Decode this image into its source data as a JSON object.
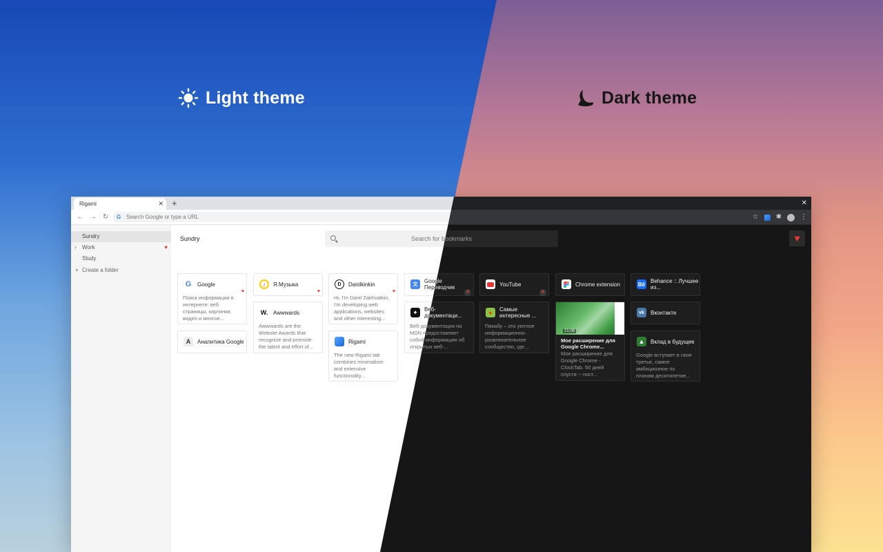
{
  "hero": {
    "light_label": "Light theme",
    "dark_label": "Dark theme",
    "light_icon": "sun-icon",
    "dark_icon": "moon-icon"
  },
  "browser": {
    "tab_title": "Rigami",
    "omnibox_placeholder": "Search Google or type a URL"
  },
  "sidebar": {
    "folders": [
      {
        "label": "Sundry"
      },
      {
        "label": "Work"
      },
      {
        "label": "Study"
      }
    ],
    "create_label": "Create a folder"
  },
  "main": {
    "folder_title": "Sundry",
    "search_placeholder": "Search for bookmarks"
  },
  "colors": {
    "heart": "#e53935",
    "dark_bg": "#161616",
    "light_bg": "#ffffff"
  },
  "cards": {
    "google": {
      "title": "Google",
      "desc": "Поиск информации в интернете: веб страницы, картинки, видео и многое..."
    },
    "analytics": {
      "title": "Аналитика Google"
    },
    "yamusic": {
      "title": "Я.Музыка"
    },
    "awwwards": {
      "title": "Awwwards",
      "desc": "Awwwards are the Website Awards that recognize and promote the talent and effort of..."
    },
    "danil": {
      "title": "Danilkinkin",
      "desc": "Hi, I'm Danil Zakhvatkin, I'm developing web applications, websites and other interesting..."
    },
    "rigami": {
      "title": "Rigami",
      "desc": "The new Rigami tab combines minimalism and extensive functionality..."
    },
    "translate": {
      "title": "Google Переводчик"
    },
    "mdn": {
      "title": "Веб-документаци...",
      "desc": "Веб-документация на MDN предоставляет собой информацию об открытых веб-..."
    },
    "youtube": {
      "title": "YouTube"
    },
    "pikabu": {
      "title": "Самые интересные ...",
      "desc": "Пикабу – это уютное информационно-развлекательное сообщество, где..."
    },
    "chrome": {
      "title": "Chrome extension"
    },
    "clocktab": {
      "title": "Мое расширение для Google Chrome...",
      "desc": "Мое расширение для Google Chrome - ClockTab. 50 дней спустя -- пост...",
      "time": "21:08"
    },
    "behance": {
      "title": "Behance :: Лучшее из..."
    },
    "vk": {
      "title": "Вконтакте"
    },
    "sber": {
      "title": "Вклад в будущее",
      "desc": "Google вступает в свое третье, самое амбициозное по планам десятилетие..."
    }
  }
}
